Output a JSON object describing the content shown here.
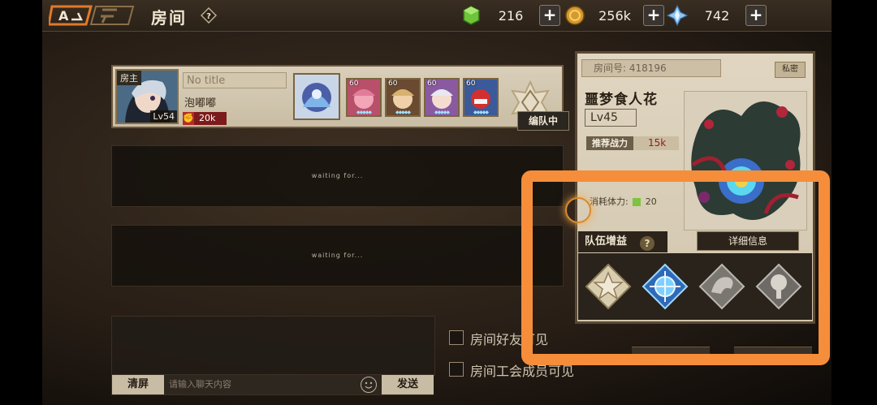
{
  "header": {
    "title": "房间"
  },
  "resources": [
    {
      "icon": "green-crystal-icon",
      "amount": "216",
      "plus": "+"
    },
    {
      "icon": "gold-coin-icon",
      "amount": "256k",
      "plus": "+"
    },
    {
      "icon": "blue-gem-icon",
      "amount": "742",
      "plus": "+"
    }
  ],
  "player": {
    "host_tag": "房主",
    "level": "Lv54",
    "title_placeholder": "No title",
    "name": "泡嘟嘟",
    "power": "20k",
    "editing_label": "编队中",
    "team_levels": [
      "60",
      "60",
      "60",
      "60"
    ]
  },
  "slots": [
    {
      "status": "waiting for..."
    },
    {
      "status": "waiting for..."
    }
  ],
  "chat": {
    "clear_label": "清屏",
    "placeholder": "请输入聊天内容",
    "send_label": "发送"
  },
  "options": [
    {
      "label": "房间好友可见"
    },
    {
      "label": "房间工会成员可见"
    }
  ],
  "room": {
    "room_no": "房间号: 418196",
    "private_label": "私密",
    "dungeon_name": "噩梦食人花",
    "level": "Lv45",
    "rec_power_label": "推荐战力",
    "rec_power_value": "15k",
    "stamina_label": "消耗体力:",
    "stamina_value": "20",
    "team_buff_label": "队伍增益",
    "buff_help": "?",
    "detail_label": "详细信息"
  },
  "colors": {
    "highlight": "#f68d3a",
    "panel": "#d9cfba",
    "dark": "#2c241b"
  }
}
